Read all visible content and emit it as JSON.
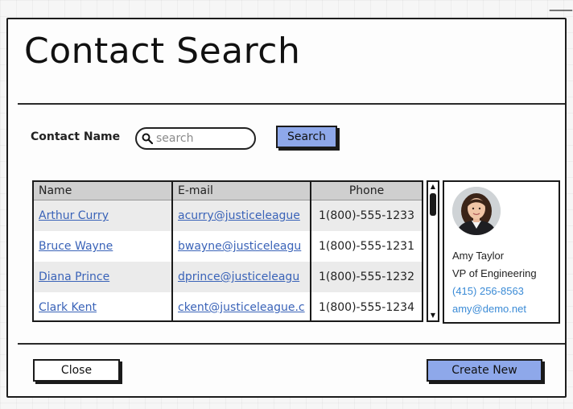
{
  "dialog": {
    "title": "Contact Search"
  },
  "search": {
    "label": "Contact Name",
    "placeholder": "search",
    "value": "",
    "button_label": "Search"
  },
  "table": {
    "headers": [
      "Name",
      "E-mail",
      "Phone"
    ],
    "rows": [
      {
        "name": "Arthur Curry",
        "email": "acurry@justiceleague",
        "phone": "1(800)-555-1233"
      },
      {
        "name": "Bruce Wayne",
        "email": "bwayne@justiceleagu",
        "phone": "1(800)-555-1231"
      },
      {
        "name": "Diana Prince",
        "email": "dprince@justiceleagu",
        "phone": "1(800)-555-1232"
      },
      {
        "name": "Clark Kent",
        "email": "ckent@justiceleague.c",
        "phone": "1(800)-555-1234"
      }
    ]
  },
  "profile": {
    "name": "Amy Taylor",
    "role": "VP of Engineering",
    "phone": "(415) 256-8563",
    "email": "amy@demo.net"
  },
  "footer": {
    "close_label": "Close",
    "create_label": "Create New"
  },
  "colors": {
    "primary_button": "#8ea8ea",
    "link": "#3a63b8",
    "profile_link": "#3b8bd6"
  },
  "icons": {
    "search": "magnifier-icon",
    "scroll_up": "triangle-up-icon",
    "scroll_down": "triangle-down-icon"
  }
}
